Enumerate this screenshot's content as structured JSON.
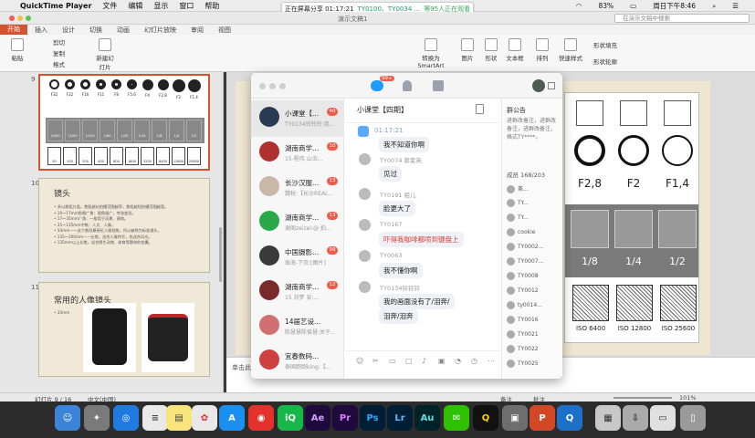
{
  "menubar": {
    "app": "QuickTime Player",
    "items": [
      "文件",
      "编辑",
      "显示",
      "窗口",
      "帮助"
    ],
    "battery": "83%",
    "clock": "周日下午8:46"
  },
  "share_banner": {
    "prefix": "正在屏幕分享 01:17:21",
    "names": "TY0100、TY0034 ...",
    "watching": "等95人正在观看"
  },
  "ppt": {
    "doc_title": "演示文稿1",
    "search_placeholder": "在演示文稿中搜索",
    "tabs": [
      "开始",
      "插入",
      "设计",
      "切换",
      "动画",
      "幻灯片放映",
      "审阅",
      "视图"
    ],
    "ribbon_labels": {
      "paste": "粘贴",
      "cut": "剪切",
      "copy": "复制",
      "format": "格式",
      "new_slide": "新建幻灯片",
      "convert": "转换为SmartArt",
      "picture": "图片",
      "shape": "形状",
      "textbox": "文本框",
      "arrange": "排列",
      "quick_styles": "快速样式",
      "shape_fill": "形状填充",
      "shape_outline": "形状轮廓"
    },
    "slide_numbers": [
      "9",
      "10",
      "11"
    ],
    "thumb9": {
      "apertures": [
        "F32",
        "F22",
        "F16",
        "F11",
        "F8",
        "F5.6",
        "F4",
        "F2.8",
        "F2",
        "F1.4"
      ],
      "speeds": [
        "1/500",
        "1/250",
        "1/125",
        "1/60",
        "1/30",
        "1/15",
        "1/8",
        "1/4",
        "1/2"
      ],
      "isos": [
        "50",
        "100",
        "200",
        "400",
        "800",
        "1600",
        "3200",
        "6400",
        "12800",
        "25600"
      ]
    },
    "thumb10": {
      "title": "镜头",
      "lines": [
        "• 多以焦距分类，焦距越长拍摄范围越窄，焦距越短拍摄范围越宽。",
        "• 10～17mm鱼眼广角：视角极广，夸张变形。",
        "• 17～35mm广角：一般用于风景、建筑。",
        "• 35～135mm中焦：人文、人像。",
        "• 50mm——这个焦段最接近人眼视角，所以被称为标准镜头。",
        "• 135～200mm——长焦，适合人像特写，也适合风光。",
        "• 135mm以上长焦，适合野生动物、体育等题材的拍摄。"
      ]
    },
    "thumb11": {
      "title": "常用的人像镜头",
      "bullet": "• 35mm"
    },
    "main_slide": {
      "apertures": [
        "F2,8",
        "F2",
        "F1,4"
      ],
      "speeds": [
        "1/8",
        "1/4",
        "1/2"
      ],
      "isos": [
        "ISO 6400",
        "ISO 12800",
        "ISO 25600"
      ]
    },
    "notes_placeholder": "单击此处添加备注",
    "status": {
      "slide": "幻灯片 9 / 16",
      "lang": "中文(中国)",
      "notes": "备注",
      "comments": "批注",
      "zoom": "101%"
    }
  },
  "qq": {
    "badge": "99+",
    "contacts": [
      {
        "name": "小课堂【...",
        "preview": "TY0134铃铃铃:我...",
        "badge": "40",
        "color": "#2a3b55"
      },
      {
        "name": "湖南商学...",
        "preview": "15-程伟 山泊...",
        "badge": "10",
        "color": "#b03030"
      },
      {
        "name": "长沙汉服...",
        "preview": "魏秋:【长沙REAL...",
        "badge": "13",
        "color": "#c8b8a8"
      },
      {
        "name": "湖南商学...",
        "preview": "谢阁zeizei:@ 拍...",
        "badge": "13",
        "color": "#2aa84a"
      },
      {
        "name": "中国摄影...",
        "preview": "珠海-下页:[图片]",
        "badge": "99",
        "color": "#3a3a3a"
      },
      {
        "name": "湖南商学...",
        "preview": "15 刘梦 安:...",
        "badge": "12",
        "color": "#7a2a2a"
      },
      {
        "name": "14届艺设...",
        "preview": "陈慧慧陈俊慧:关于...",
        "badge": "",
        "color": "#d07070"
      },
      {
        "name": "宜春数码...",
        "preview": "泰国跑跑king:【...",
        "badge": "",
        "color": "#d04040"
      }
    ],
    "chat_title": "小课堂【四期】",
    "time": "01:17:21",
    "messages": [
      {
        "name": "",
        "text": "我不知道你啊",
        "red": false
      },
      {
        "name": "TY0074 蔡紫英",
        "text": "见过",
        "red": false
      },
      {
        "name": "TY0191 祖儿",
        "text": "脸更大了",
        "red": false
      },
      {
        "name": "TY0167",
        "text": "吓得我咖啡都喷到键盘上",
        "red": true
      },
      {
        "name": "TY0063 ",
        "text": "我不懂你啊",
        "red": false
      },
      {
        "name": "TY0134铃铃铃",
        "text": "我的画面没有了/泪奔/",
        "red": false
      },
      {
        "name": "",
        "text": "泪奔/泪奔",
        "red": false
      }
    ],
    "notice_title": "群公告",
    "notice_text": "进群改备注，进群改备注，进群改备注，格式TY****。",
    "members_title": "成员 168/203",
    "members": [
      "茶...",
      "TY...",
      "TY...",
      "cookie",
      "TY0002...",
      "TY0007...",
      "TY0008",
      "TY0012",
      "ty0014...",
      "TY0016",
      "TY0021",
      "TY0022",
      "TY0025"
    ]
  }
}
